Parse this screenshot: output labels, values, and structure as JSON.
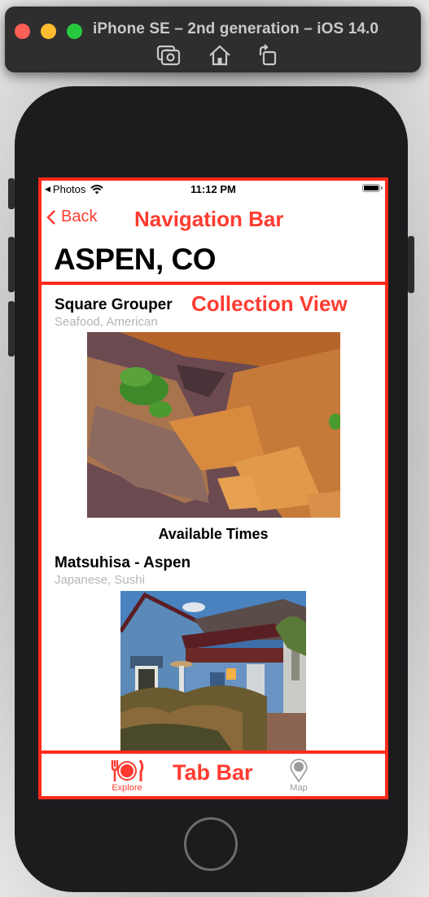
{
  "window": {
    "title": "iPhone SE – 2nd generation – iOS 14.0",
    "toolbar_icons": [
      "screenshot-icon",
      "home-icon",
      "rotate-icon"
    ]
  },
  "status_bar": {
    "back_app": "Photos",
    "time": "11:12 PM",
    "wifi": true,
    "battery_level": 1.0
  },
  "nav": {
    "back_label": "Back",
    "annotation": "Navigation Bar",
    "large_title": "ASPEN, CO"
  },
  "collection": {
    "annotation": "Collection View",
    "items": [
      {
        "name": "Square Grouper",
        "cuisine": "Seafood, American",
        "image": "ribs-photo",
        "action_label": "Available Times"
      },
      {
        "name": "Matsuhisa - Aspen",
        "cuisine": "Japanese, Sushi",
        "image": "restaurant-house-photo"
      }
    ]
  },
  "tabbar": {
    "annotation": "Tab Bar",
    "items": [
      {
        "label": "Explore",
        "icon": "plate-utensils-icon",
        "selected": true
      },
      {
        "label": "Map",
        "icon": "map-pin-icon",
        "selected": false
      }
    ]
  },
  "colors": {
    "accent": "#ff3b30",
    "annotation_outline": "#ff2a1a",
    "inactive_tab": "#9a9a9a",
    "subtitle": "#b5b5b5"
  }
}
